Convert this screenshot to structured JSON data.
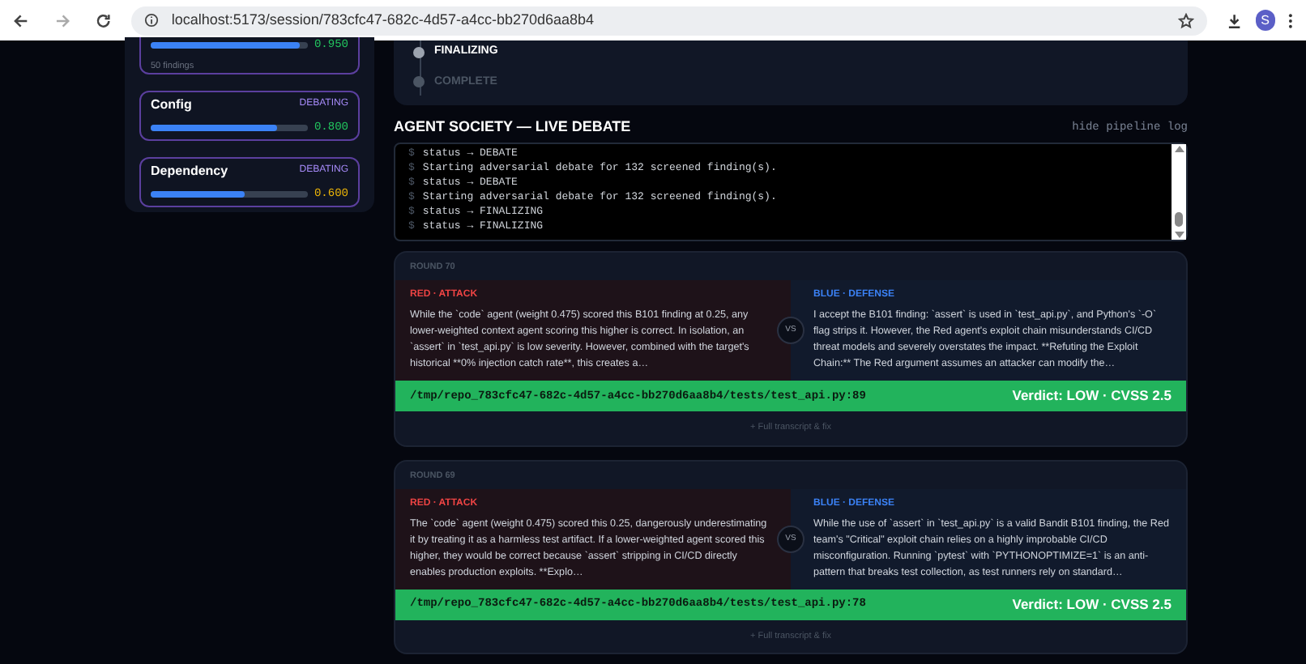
{
  "browser": {
    "url": "localhost:5173/session/783cfc47-682c-4d57-a4cc-bb270d6aa8b4",
    "avatar": "S"
  },
  "agents": [
    {
      "level": 0.95,
      "score": "0.950",
      "note": "50 findings"
    },
    {
      "name": "Config",
      "status": "DEBATING",
      "level": 0.8,
      "score": "0.800"
    },
    {
      "name": "Dependency",
      "status": "DEBATING",
      "level": 0.6,
      "score": "0.600"
    }
  ],
  "pipeline": [
    {
      "label": "FINALIZING",
      "done": true
    },
    {
      "label": "COMPLETE",
      "done": false
    }
  ],
  "debate": {
    "title": "AGENT SOCIETY — LIVE DEBATE",
    "toggle": "hide pipeline log",
    "log": [
      {
        "prompt": "$",
        "text": "status → DEBATE"
      },
      {
        "prompt": "$",
        "text": "Starting adversarial debate for 132 screened finding(s)."
      },
      {
        "prompt": "$",
        "text": "status → DEBATE"
      },
      {
        "prompt": "$",
        "text": "Starting adversarial debate for 132 screened finding(s)."
      },
      {
        "prompt": "$",
        "text": "status → FINALIZING"
      },
      {
        "prompt": "$",
        "text": "status → FINALIZING"
      }
    ]
  },
  "rounds": [
    {
      "label": "ROUND 70",
      "red_label": "RED · ATTACK",
      "red_text": "While the `code` agent (weight 0.475) scored this B101 finding at 0.25, any lower-weighted context agent scoring this higher is correct. In isolation, an `assert` in `test_api.py` is low severity. However, combined with the target's historical **0% injection catch rate**, this creates a…",
      "vs": "VS",
      "blue_label": "BLUE · DEFENSE",
      "blue_text": "I accept the B101 finding: `assert` is used in `test_api.py`, and Python's `-O` flag strips it. However, the Red agent's exploit chain misunderstands CI/CD threat models and severely overstates the impact. **Refuting the Exploit Chain:** The Red argument assumes an attacker can modify the…",
      "path": "/tmp/repo_783cfc47-682c-4d57-a4cc-bb270d6aa8b4/tests/test_api.py:89",
      "verdict": "Verdict: LOW · CVSS 2.5",
      "more": "+ Full transcript & fix"
    },
    {
      "label": "ROUND 69",
      "red_label": "RED · ATTACK",
      "red_text": "The `code` agent (weight 0.475) scored this 0.25, dangerously underestimating it by treating it as a harmless test artifact. If a lower-weighted agent scored this higher, they would be correct because `assert` stripping in CI/CD directly enables production exploits. **Explo…",
      "vs": "VS",
      "blue_label": "BLUE · DEFENSE",
      "blue_text": "While the use of `assert` in `test_api.py` is a valid Bandit B101 finding, the Red team's \"Critical\" exploit chain relies on a highly improbable CI/CD misconfiguration. Running `pytest` with `PYTHONOPTIMIZE=1` is an anti-pattern that breaks test collection, as test runners rely on standard…",
      "path": "/tmp/repo_783cfc47-682c-4d57-a4cc-bb270d6aa8b4/tests/test_api.py:78",
      "verdict": "Verdict: LOW · CVSS 2.5",
      "more": "+ Full transcript & fix"
    }
  ]
}
